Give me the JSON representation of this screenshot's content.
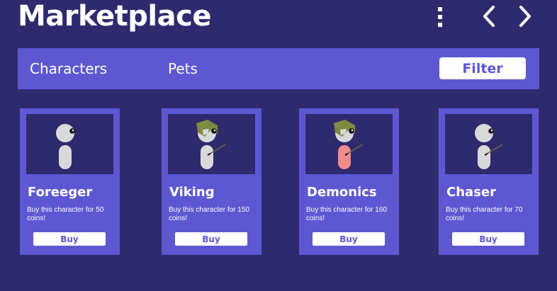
{
  "header": {
    "title": "Marketplace",
    "menu_icon": "more-vertical-icon",
    "prev_icon": "chevron-left-icon",
    "next_icon": "chevron-right-icon"
  },
  "tabs": [
    {
      "label": "Characters"
    },
    {
      "label": "Pets"
    }
  ],
  "filter_label": "Filter",
  "cards": [
    {
      "name": "Foreeger",
      "description": "Buy this character for 50 coins!",
      "buy_label": "Buy",
      "body_color": "#d9d9d9",
      "helmet": false,
      "spear": false
    },
    {
      "name": "Viking",
      "description": "Buy this character for 150 coins!",
      "buy_label": "Buy",
      "body_color": "#d9d9d9",
      "helmet": true,
      "spear": true
    },
    {
      "name": "Demonics",
      "description": "Buy this character for 160 coins!",
      "buy_label": "Buy",
      "body_color": "#f28b8b",
      "helmet": true,
      "spear": true
    },
    {
      "name": "Chaser",
      "description": "Buy this character for 70 coins!",
      "buy_label": "Buy",
      "body_color": "#d9d9d9",
      "helmet": false,
      "spear": true
    }
  ],
  "colors": {
    "background": "#2f2a6e",
    "accent": "#5d58d2",
    "text": "#ffffff",
    "helmet": "#7e8a3f"
  }
}
